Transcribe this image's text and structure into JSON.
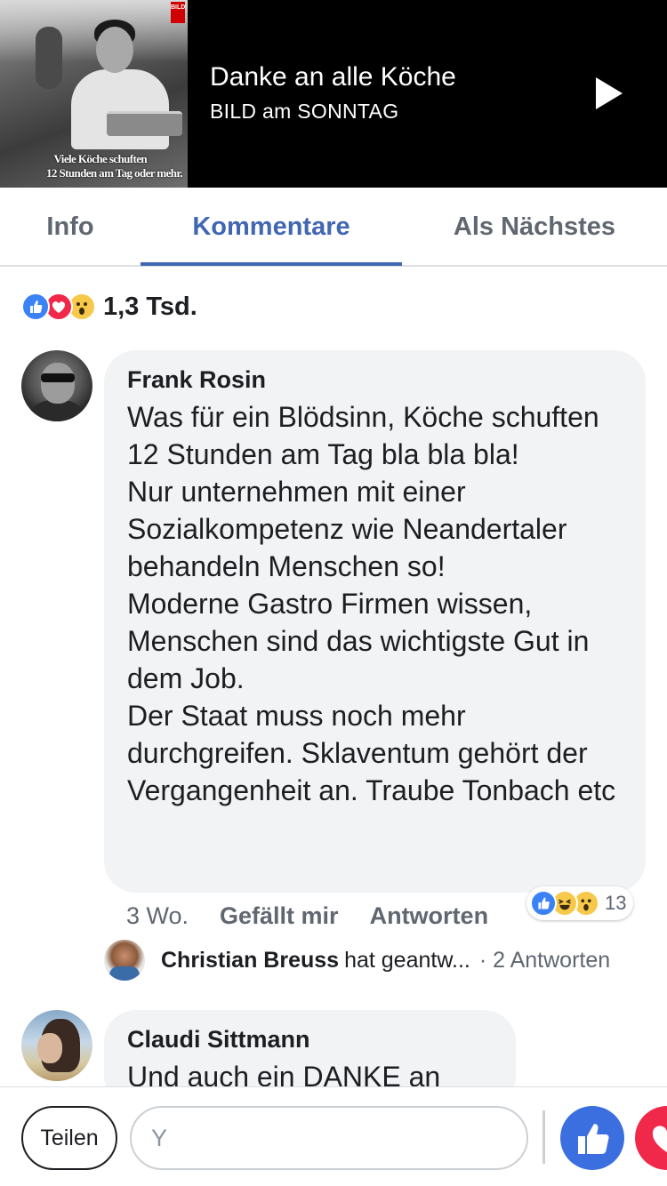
{
  "video": {
    "thumbnail_logo": "BILD",
    "thumbnail_caption_line1": "Viele Köche schuften",
    "thumbnail_caption_line2": "12 Stunden am Tag oder mehr.",
    "title": "Danke an alle Köche",
    "source": "BILD am SONNTAG",
    "play_icon": "play-icon"
  },
  "tabs": [
    {
      "label": "Info",
      "active": false
    },
    {
      "label": "Kommentare",
      "active": true
    },
    {
      "label": "Als Nächstes",
      "active": false
    }
  ],
  "reactions_summary": {
    "icons": [
      "like-icon",
      "love-icon",
      "wow-icon"
    ],
    "count": "1,3 Tsd."
  },
  "comments": [
    {
      "author": "Frank Rosin",
      "text": "Was für ein Blödsinn, Köche schuften 12 Stunden am Tag bla bla bla!\nNur unternehmen mit einer Sozialkompetenz wie Neandertaler behandeln Menschen so!\nModerne Gastro Firmen wissen, Menschen sind das wichtigste Gut in dem Job.\nDer Staat muss noch mehr durchgreifen. Sklaventum gehört der Vergangenheit an. Traube Tonbach etc",
      "time": "3 Wo.",
      "like_label": "Gefällt mir",
      "reply_label": "Antworten",
      "reactions": {
        "icons": [
          "like-icon",
          "haha-icon",
          "wow-icon"
        ],
        "count": "13"
      },
      "replies": {
        "author": "Christian Breuss",
        "action": "hat geantw...",
        "count": "· 2 Antworten"
      }
    },
    {
      "author": "Claudi Sittmann",
      "text": "Und auch ein DANKE an"
    }
  ],
  "bottom_bar": {
    "share_label": "Teilen",
    "input_placeholder": "Y"
  },
  "colors": {
    "accent": "#4267b2",
    "like": "#3b82f6",
    "love": "#f0284a",
    "bubble": "#f2f3f5"
  }
}
